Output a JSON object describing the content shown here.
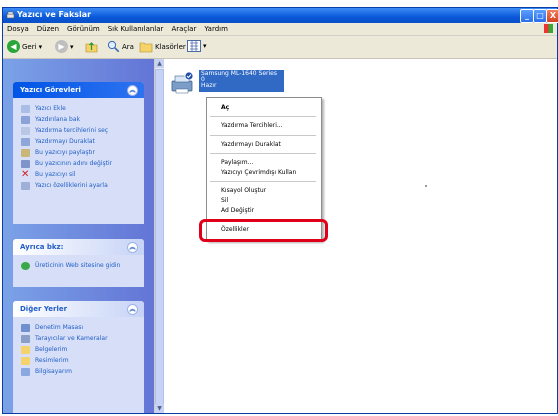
{
  "window": {
    "title": "Yazıcı ve Fakslar",
    "controls": [
      "_",
      "□",
      "X"
    ]
  },
  "menubar": [
    "Dosya",
    "Düzen",
    "Görünüm",
    "Sık Kullanılanlar",
    "Araçlar",
    "Yardım"
  ],
  "toolbar": {
    "back": "Geri",
    "search": "Ara",
    "folders": "Klasörler"
  },
  "sidebar": {
    "printer_tasks": {
      "title": "Yazıcı Görevleri",
      "items": [
        "Yazıcı Ekle",
        "Yazdırılana bak",
        "Yazdırma tercihlerini seç",
        "Yazdırmayı Duraklat",
        "Bu yazıcıyı paylaştır",
        "Bu yazıcının adını değiştir",
        "Bu yazıcıyı sil",
        "Yazıcı özelliklerini ayarla"
      ]
    },
    "see_also": {
      "title": "Ayrıca bkz:",
      "items": [
        "Üreticinin Web sitesine gidin"
      ]
    },
    "other_places": {
      "title": "Diğer Yerler",
      "items": [
        "Denetim Masası",
        "Tarayıcılar ve Kameralar",
        "Belgelerim",
        "Resimlerim",
        "Bilgisayarım"
      ]
    }
  },
  "printer": {
    "name": "Samsung ML-1640 Series",
    "line2": "0",
    "line3": "Hazır"
  },
  "context_menu": {
    "items": [
      "Aç",
      "Yazdırma Tercihleri...",
      "Yazdırmayı Duraklat",
      "Paylaşım...",
      "Yazıcıyı Çevrimdışı Kullan",
      "Kısayol Oluştur",
      "Sil",
      "Ad Değiştir",
      "Özellikler"
    ]
  },
  "colors": {
    "titlebar": "#0a58d8",
    "selection": "#316ac5",
    "highlight_box": "#e0001a"
  }
}
